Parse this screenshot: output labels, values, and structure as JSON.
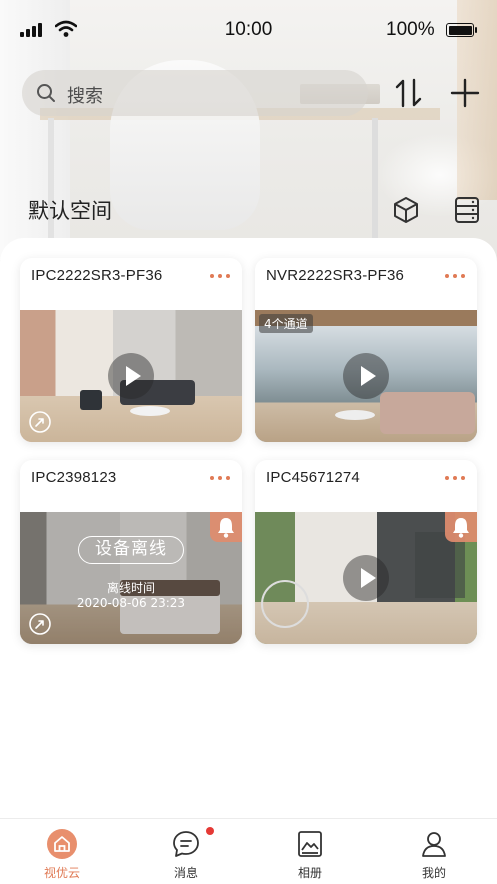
{
  "status_bar": {
    "time": "10:00",
    "battery": "100%"
  },
  "search": {
    "placeholder": "搜索"
  },
  "space": {
    "title": "默认空间"
  },
  "devices": [
    {
      "name": "IPC2222SR3-PF36",
      "status": "online"
    },
    {
      "name": "NVR2222SR3-PF36",
      "status": "online",
      "channels": "4个通道"
    },
    {
      "name": "IPC2398123",
      "status": "offline",
      "offline_label": "设备离线",
      "offline_time_label": "离线时间",
      "offline_time": "2020-08-06 23:23"
    },
    {
      "name": "IPC45671274",
      "status": "online"
    }
  ],
  "tabs": [
    {
      "label": "视优云",
      "icon": "home-icon",
      "active": true
    },
    {
      "label": "消息",
      "icon": "message-icon",
      "badge": true
    },
    {
      "label": "相册",
      "icon": "album-icon"
    },
    {
      "label": "我的",
      "icon": "profile-icon"
    }
  ],
  "colors": {
    "accent": "#e07a55",
    "badge": "#e53935"
  }
}
